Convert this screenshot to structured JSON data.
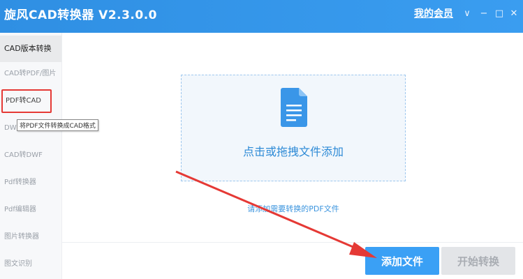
{
  "app": {
    "title": "旋风CAD转换器 V2.3.0.0",
    "member_link": "我的会员"
  },
  "window_controls": {
    "dropdown_glyph": "∨",
    "minimize_glyph": "−",
    "maximize_glyph": "□",
    "close_glyph": "✕"
  },
  "sidebar": {
    "items": [
      {
        "label": "CAD版本转换"
      },
      {
        "label": "CAD转PDF/图片"
      },
      {
        "label": "PDF转CAD"
      },
      {
        "label": "DW"
      },
      {
        "label": "CAD转DWF"
      },
      {
        "label": "Pdf转换器"
      },
      {
        "label": "Pdf编辑器"
      },
      {
        "label": "图片转换器"
      },
      {
        "label": "图文识别"
      }
    ],
    "tooltip": "将PDF文件转换成CAD格式"
  },
  "main": {
    "dropzone_text": "点击或拖拽文件添加",
    "hint_text": "请添加需要转换的PDF文件"
  },
  "buttons": {
    "add_file": "添加文件",
    "start_convert": "开始转换"
  },
  "colors": {
    "titlebar": "#3a9df0",
    "accent_blue": "#3aa0f5",
    "annotation_red": "#e53935"
  },
  "icons": {
    "file": "document-icon",
    "annotation": "red-arrow-annotation"
  }
}
